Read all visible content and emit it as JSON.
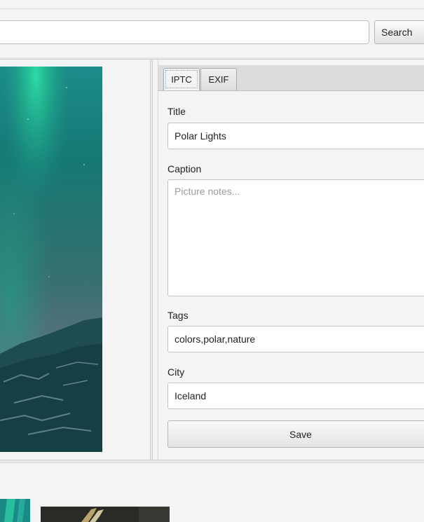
{
  "search": {
    "value": "",
    "button_label": "Search"
  },
  "tabs": [
    {
      "label": "IPTC",
      "selected": true
    },
    {
      "label": "EXIF",
      "selected": false
    }
  ],
  "form": {
    "title": {
      "label": "Title",
      "value": "Polar Lights"
    },
    "caption": {
      "label": "Caption",
      "value": "",
      "placeholder": "Picture notes..."
    },
    "tags": {
      "label": "Tags",
      "value": "colors,polar,nature"
    },
    "city": {
      "label": "City",
      "value": "Iceland"
    },
    "save_label": "Save"
  },
  "colors": {
    "aurora_green": "#1fc69a",
    "sky_teal": "#1d7f80",
    "sky_dusk": "#5b6f7e",
    "mountain_dark": "#12393c"
  }
}
